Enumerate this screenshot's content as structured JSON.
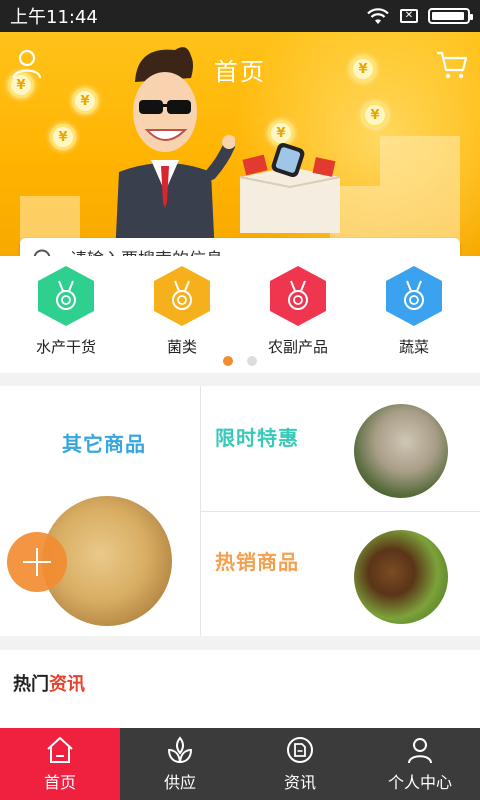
{
  "status_bar": {
    "time": "上午11:44",
    "battery_level": 0.95
  },
  "header": {
    "title": "首页"
  },
  "banner": {
    "coin_symbol": "¥"
  },
  "search": {
    "placeholder": "请输入要搜索的信息"
  },
  "categories": [
    {
      "label": "水产干货",
      "color": "#2fcf8f"
    },
    {
      "label": "菌类",
      "color": "#f5b01b"
    },
    {
      "label": "农副产品",
      "color": "#f0364f"
    },
    {
      "label": "蔬菜",
      "color": "#3aa2ee"
    }
  ],
  "pager": {
    "count": 2,
    "active": 0
  },
  "promos": {
    "other": "其它商品",
    "flash": "限时特惠",
    "hot": "热销商品"
  },
  "news": {
    "head_part1": "热门",
    "head_part2": "资讯"
  },
  "nav": [
    {
      "label": "首页",
      "icon": "home-icon",
      "active": true
    },
    {
      "label": "供应",
      "icon": "leaf-icon",
      "active": false
    },
    {
      "label": "资讯",
      "icon": "news-icon",
      "active": false
    },
    {
      "label": "个人中心",
      "icon": "person-icon",
      "active": false
    }
  ]
}
